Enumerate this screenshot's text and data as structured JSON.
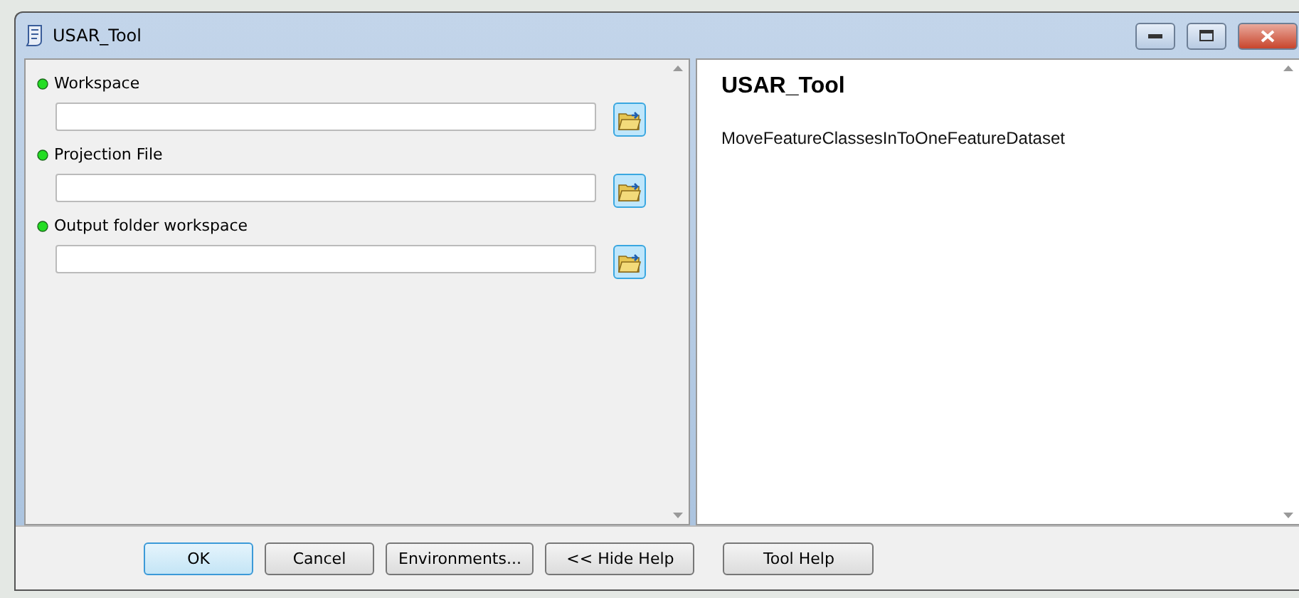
{
  "window": {
    "title": "USAR_Tool"
  },
  "parameters": [
    {
      "label": "Workspace"
    },
    {
      "label": "Projection File"
    },
    {
      "label": "Output folder workspace"
    }
  ],
  "help": {
    "title": "USAR_Tool",
    "text": "MoveFeatureClassesInToOneFeatureDataset"
  },
  "buttons": [
    {
      "label": "OK",
      "focused": true
    },
    {
      "label": "Cancel",
      "focused": false
    },
    {
      "label": "Environments...",
      "focused": false
    },
    {
      "label": "<< Hide Help",
      "focused": false
    },
    {
      "label": "Tool Help",
      "focused": false
    }
  ]
}
